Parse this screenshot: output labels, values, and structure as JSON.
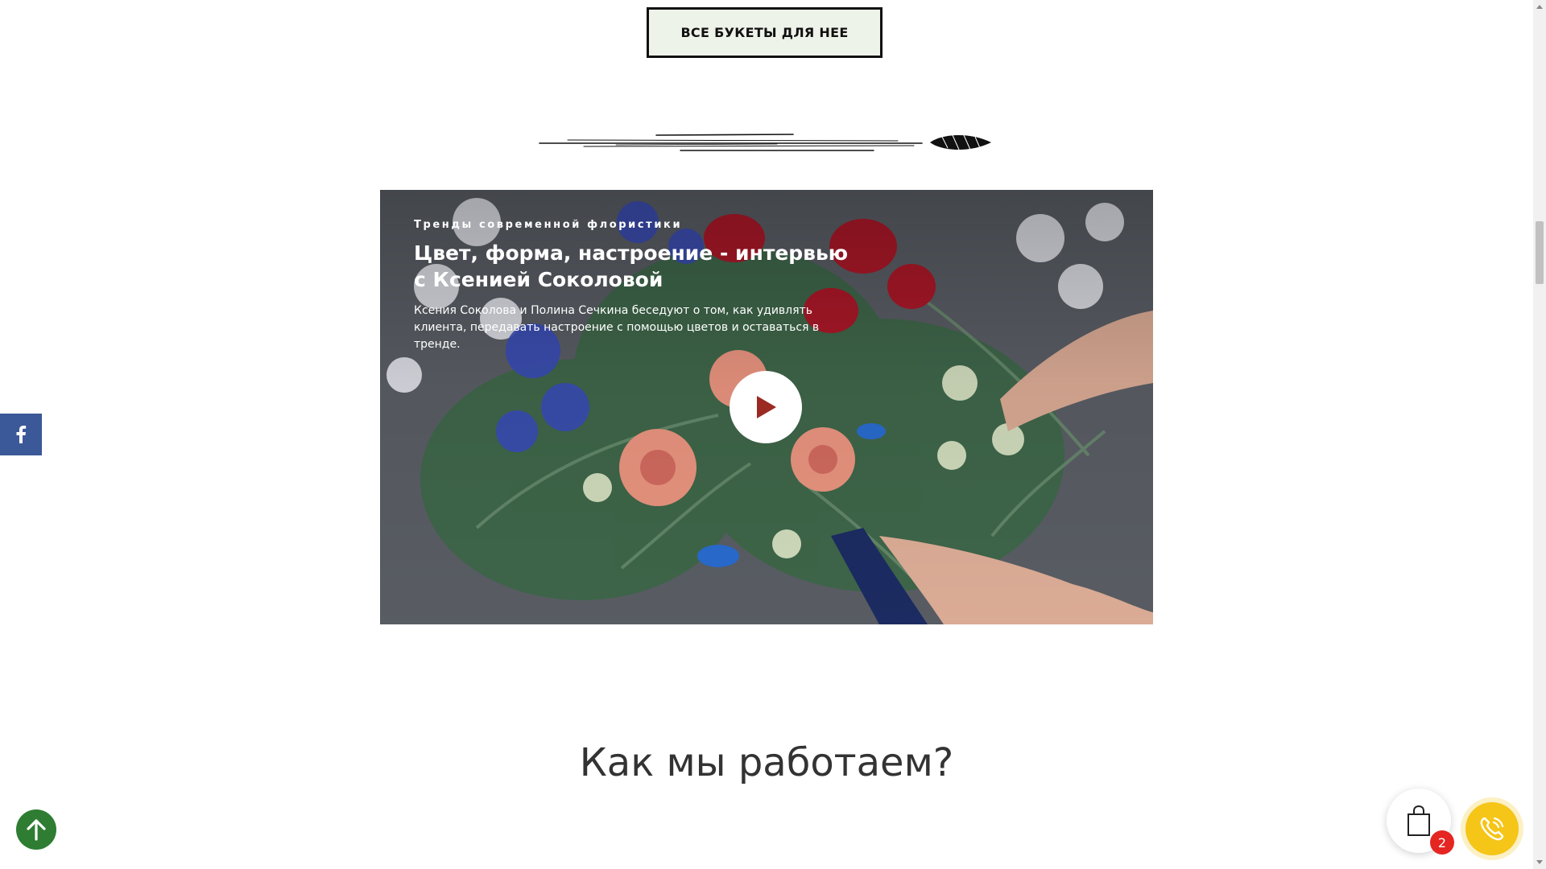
{
  "cta": {
    "label": "ВСЕ БУКЕТЫ ДЛЯ НЕЕ"
  },
  "video": {
    "kicker": "Тренды современной флористики",
    "title": "Цвет, форма, настроение - интервью с Ксенией Соколовой",
    "description": "Ксения Соколова и Полина Сечкина беседуют о том, как удивлять клиента, передавать настроение с помощью цветов и оставаться в тренде.",
    "play_icon": "play-icon"
  },
  "section": {
    "heading": "Как мы работаем?"
  },
  "widgets": {
    "facebook_icon": "facebook-icon",
    "scroll_up_icon": "arrow-up-icon",
    "cart_icon": "shopping-bag-icon",
    "cart_count": "2",
    "call_icon": "phone-icon"
  },
  "colors": {
    "cta_bg": "#eef3ea",
    "facebook": "#3b5998",
    "scroll_up": "#2e7d32",
    "badge": "#e52521",
    "call": "#f5c518"
  }
}
